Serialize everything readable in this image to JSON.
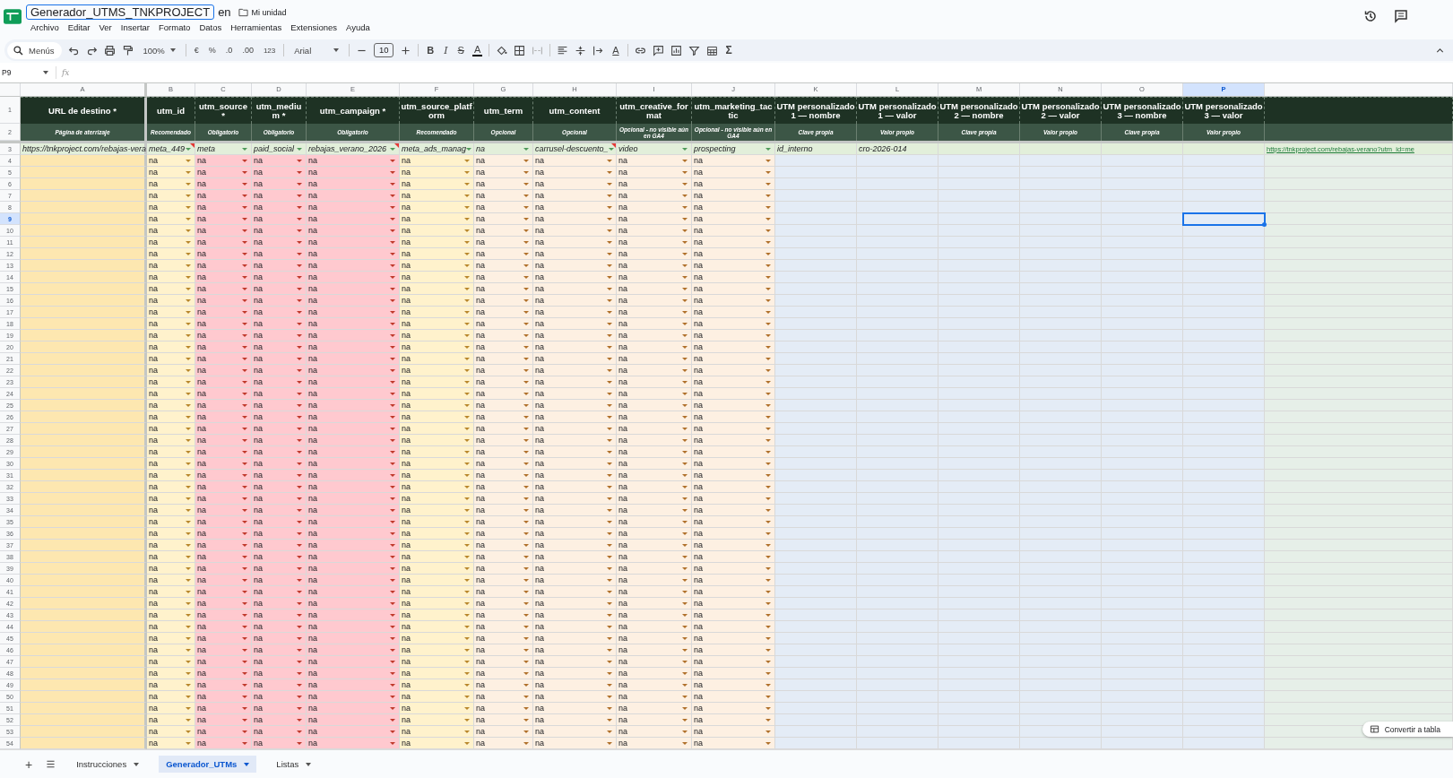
{
  "app": {
    "title": "Generador_UTMS_TNKPROJECT",
    "location_prefix": "en",
    "location": "Mi unidad",
    "menu": [
      "Archivo",
      "Editar",
      "Ver",
      "Insertar",
      "Formato",
      "Datos",
      "Herramientas",
      "Extensiones",
      "Ayuda"
    ]
  },
  "toolbar": {
    "search": "Menús",
    "zoom": "100%",
    "currency": "€",
    "percent": "%",
    "decrease_decimals": ".0",
    "increase_decimals": ".00",
    "more_formats": "123",
    "font": "Arial",
    "font_size": "10",
    "bold": "B",
    "italic": "I",
    "strikethrough": "S",
    "text_color": "A",
    "text_rotation": "A",
    "functions": "Σ"
  },
  "formula_bar": {
    "name_box": "P9",
    "fx": "fx"
  },
  "columns": [
    {
      "letter": "A",
      "title": "URL de destino *",
      "hint": "Página de aterrizaje",
      "kind": "url",
      "selected": false
    },
    {
      "letter": "B",
      "title": "utm_id",
      "hint": "Recomendado",
      "kind": "recommended",
      "selected": false
    },
    {
      "letter": "C",
      "title": "utm_source *",
      "hint": "Obligatorio",
      "kind": "required",
      "selected": false
    },
    {
      "letter": "D",
      "title": "utm_medium *",
      "hint": "Obligatorio",
      "kind": "required",
      "selected": false
    },
    {
      "letter": "E",
      "title": "utm_campaign *",
      "hint": "Obligatorio",
      "kind": "required",
      "selected": false
    },
    {
      "letter": "F",
      "title": "utm_source_platform",
      "hint": "Recomendado",
      "kind": "recommended",
      "selected": false
    },
    {
      "letter": "G",
      "title": "utm_term",
      "hint": "Opcional",
      "kind": "optional",
      "selected": false
    },
    {
      "letter": "H",
      "title": "utm_content",
      "hint": "Opcional",
      "kind": "optional",
      "selected": false
    },
    {
      "letter": "I",
      "title": "utm_creative_format",
      "hint": "Opcional - no visible aún en GA4",
      "kind": "optional",
      "selected": false
    },
    {
      "letter": "J",
      "title": "utm_marketing_tactic",
      "hint": "Opcional - no visible aún en GA4",
      "kind": "optional",
      "selected": false
    },
    {
      "letter": "K",
      "title": "UTM personalizado 1 — nombre",
      "hint": "Clave propia",
      "kind": "custom",
      "selected": false
    },
    {
      "letter": "L",
      "title": "UTM personalizado 1 — valor",
      "hint": "Valor propio",
      "kind": "custom",
      "selected": false
    },
    {
      "letter": "M",
      "title": "UTM personalizado 2 — nombre",
      "hint": "Clave propia",
      "kind": "custom",
      "selected": false
    },
    {
      "letter": "N",
      "title": "UTM personalizado 2 — valor",
      "hint": "Valor propio",
      "kind": "custom",
      "selected": false
    },
    {
      "letter": "O",
      "title": "UTM personalizado 3 — nombre",
      "hint": "Clave propia",
      "kind": "custom",
      "selected": false
    },
    {
      "letter": "P",
      "title": "UTM personalizado 3 — valor",
      "hint": "Valor propio",
      "kind": "custom",
      "selected": true
    }
  ],
  "header_rows": [
    "1",
    "2"
  ],
  "example_row": {
    "number": "3",
    "cells": [
      {
        "value": "https://tnkproject.com/rebajas-vera",
        "kind": "text",
        "note": false
      },
      {
        "value": "meta_449",
        "kind": "dropdown",
        "note": true
      },
      {
        "value": "meta",
        "kind": "dropdown",
        "note": false
      },
      {
        "value": "paid_social",
        "kind": "dropdown",
        "note": false
      },
      {
        "value": "rebajas_verano_2026",
        "kind": "dropdown",
        "note": true
      },
      {
        "value": "meta_ads_manag",
        "kind": "dropdown",
        "note": false
      },
      {
        "value": "na",
        "kind": "dropdown",
        "note": false
      },
      {
        "value": "carrusel-descuento_",
        "kind": "dropdown",
        "note": true
      },
      {
        "value": "video",
        "kind": "dropdown",
        "note": false
      },
      {
        "value": "prospecting",
        "kind": "dropdown",
        "note": false
      },
      {
        "value": "id_interno",
        "kind": "text",
        "note": false
      },
      {
        "value": "cro-2026-014",
        "kind": "text",
        "note": false
      }
    ],
    "generated_url": "https://tnkproject.com/rebajas-verano?utm_id=me"
  },
  "rows": [
    {
      "number": "4",
      "selected": false,
      "cells": [
        "na",
        "na",
        "na",
        "na",
        "na",
        "na",
        "na",
        "na",
        "na"
      ]
    },
    {
      "number": "5",
      "selected": false,
      "cells": [
        "na",
        "na",
        "na",
        "na",
        "na",
        "na",
        "na",
        "na",
        "na"
      ]
    },
    {
      "number": "6",
      "selected": false,
      "cells": [
        "na",
        "na",
        "na",
        "na",
        "na",
        "na",
        "na",
        "na",
        "na"
      ]
    },
    {
      "number": "7",
      "selected": false,
      "cells": [
        "na",
        "na",
        "na",
        "na",
        "na",
        "na",
        "na",
        "na",
        "na"
      ]
    },
    {
      "number": "8",
      "selected": false,
      "cells": [
        "na",
        "na",
        "na",
        "na",
        "na",
        "na",
        "na",
        "na",
        "na"
      ]
    },
    {
      "number": "9",
      "selected": true,
      "cells": [
        "na",
        "na",
        "na",
        "na",
        "na",
        "na",
        "na",
        "na",
        "na"
      ]
    },
    {
      "number": "10",
      "selected": false,
      "cells": [
        "na",
        "na",
        "na",
        "na",
        "na",
        "na",
        "na",
        "na",
        "na"
      ]
    },
    {
      "number": "11",
      "selected": false,
      "cells": [
        "na",
        "na",
        "na",
        "na",
        "na",
        "na",
        "na",
        "na",
        "na"
      ]
    },
    {
      "number": "12",
      "selected": false,
      "cells": [
        "na",
        "na",
        "na",
        "na",
        "na",
        "na",
        "na",
        "na",
        "na"
      ]
    },
    {
      "number": "13",
      "selected": false,
      "cells": [
        "na",
        "na",
        "na",
        "na",
        "na",
        "na",
        "na",
        "na",
        "na"
      ]
    },
    {
      "number": "14",
      "selected": false,
      "cells": [
        "na",
        "na",
        "na",
        "na",
        "na",
        "na",
        "na",
        "na",
        "na"
      ]
    },
    {
      "number": "15",
      "selected": false,
      "cells": [
        "na",
        "na",
        "na",
        "na",
        "na",
        "na",
        "na",
        "na",
        "na"
      ]
    },
    {
      "number": "16",
      "selected": false,
      "cells": [
        "na",
        "na",
        "na",
        "na",
        "na",
        "na",
        "na",
        "na",
        "na"
      ]
    },
    {
      "number": "17",
      "selected": false,
      "cells": [
        "na",
        "na",
        "na",
        "na",
        "na",
        "na",
        "na",
        "na",
        "na"
      ]
    },
    {
      "number": "18",
      "selected": false,
      "cells": [
        "na",
        "na",
        "na",
        "na",
        "na",
        "na",
        "na",
        "na",
        "na"
      ]
    },
    {
      "number": "19",
      "selected": false,
      "cells": [
        "na",
        "na",
        "na",
        "na",
        "na",
        "na",
        "na",
        "na",
        "na"
      ]
    },
    {
      "number": "20",
      "selected": false,
      "cells": [
        "na",
        "na",
        "na",
        "na",
        "na",
        "na",
        "na",
        "na",
        "na"
      ]
    },
    {
      "number": "21",
      "selected": false,
      "cells": [
        "na",
        "na",
        "na",
        "na",
        "na",
        "na",
        "na",
        "na",
        "na"
      ]
    },
    {
      "number": "22",
      "selected": false,
      "cells": [
        "na",
        "na",
        "na",
        "na",
        "na",
        "na",
        "na",
        "na",
        "na"
      ]
    },
    {
      "number": "23",
      "selected": false,
      "cells": [
        "na",
        "na",
        "na",
        "na",
        "na",
        "na",
        "na",
        "na",
        "na"
      ]
    },
    {
      "number": "24",
      "selected": false,
      "cells": [
        "na",
        "na",
        "na",
        "na",
        "na",
        "na",
        "na",
        "na",
        "na"
      ]
    },
    {
      "number": "25",
      "selected": false,
      "cells": [
        "na",
        "na",
        "na",
        "na",
        "na",
        "na",
        "na",
        "na",
        "na"
      ]
    },
    {
      "number": "26",
      "selected": false,
      "cells": [
        "na",
        "na",
        "na",
        "na",
        "na",
        "na",
        "na",
        "na",
        "na"
      ]
    },
    {
      "number": "27",
      "selected": false,
      "cells": [
        "na",
        "na",
        "na",
        "na",
        "na",
        "na",
        "na",
        "na",
        "na"
      ]
    },
    {
      "number": "28",
      "selected": false,
      "cells": [
        "na",
        "na",
        "na",
        "na",
        "na",
        "na",
        "na",
        "na",
        "na"
      ]
    },
    {
      "number": "29",
      "selected": false,
      "cells": [
        "na",
        "na",
        "na",
        "na",
        "na",
        "na",
        "na",
        "na",
        "na"
      ]
    },
    {
      "number": "30",
      "selected": false,
      "cells": [
        "na",
        "na",
        "na",
        "na",
        "na",
        "na",
        "na",
        "na",
        "na"
      ]
    },
    {
      "number": "31",
      "selected": false,
      "cells": [
        "na",
        "na",
        "na",
        "na",
        "na",
        "na",
        "na",
        "na",
        "na"
      ]
    },
    {
      "number": "32",
      "selected": false,
      "cells": [
        "na",
        "na",
        "na",
        "na",
        "na",
        "na",
        "na",
        "na",
        "na"
      ]
    },
    {
      "number": "33",
      "selected": false,
      "cells": [
        "na",
        "na",
        "na",
        "na",
        "na",
        "na",
        "na",
        "na",
        "na"
      ]
    },
    {
      "number": "34",
      "selected": false,
      "cells": [
        "na",
        "na",
        "na",
        "na",
        "na",
        "na",
        "na",
        "na",
        "na"
      ]
    },
    {
      "number": "35",
      "selected": false,
      "cells": [
        "na",
        "na",
        "na",
        "na",
        "na",
        "na",
        "na",
        "na",
        "na"
      ]
    },
    {
      "number": "36",
      "selected": false,
      "cells": [
        "na",
        "na",
        "na",
        "na",
        "na",
        "na",
        "na",
        "na",
        "na"
      ]
    },
    {
      "number": "37",
      "selected": false,
      "cells": [
        "na",
        "na",
        "na",
        "na",
        "na",
        "na",
        "na",
        "na",
        "na"
      ]
    },
    {
      "number": "38",
      "selected": false,
      "cells": [
        "na",
        "na",
        "na",
        "na",
        "na",
        "na",
        "na",
        "na",
        "na"
      ]
    },
    {
      "number": "39",
      "selected": false,
      "cells": [
        "na",
        "na",
        "na",
        "na",
        "na",
        "na",
        "na",
        "na",
        "na"
      ]
    },
    {
      "number": "40",
      "selected": false,
      "cells": [
        "na",
        "na",
        "na",
        "na",
        "na",
        "na",
        "na",
        "na",
        "na"
      ]
    },
    {
      "number": "41",
      "selected": false,
      "cells": [
        "na",
        "na",
        "na",
        "na",
        "na",
        "na",
        "na",
        "na",
        "na"
      ]
    },
    {
      "number": "42",
      "selected": false,
      "cells": [
        "na",
        "na",
        "na",
        "na",
        "na",
        "na",
        "na",
        "na",
        "na"
      ]
    },
    {
      "number": "43",
      "selected": false,
      "cells": [
        "na",
        "na",
        "na",
        "na",
        "na",
        "na",
        "na",
        "na",
        "na"
      ]
    },
    {
      "number": "44",
      "selected": false,
      "cells": [
        "na",
        "na",
        "na",
        "na",
        "na",
        "na",
        "na",
        "na",
        "na"
      ]
    },
    {
      "number": "45",
      "selected": false,
      "cells": [
        "na",
        "na",
        "na",
        "na",
        "na",
        "na",
        "na",
        "na",
        "na"
      ]
    },
    {
      "number": "46",
      "selected": false,
      "cells": [
        "na",
        "na",
        "na",
        "na",
        "na",
        "na",
        "na",
        "na",
        "na"
      ]
    },
    {
      "number": "47",
      "selected": false,
      "cells": [
        "na",
        "na",
        "na",
        "na",
        "na",
        "na",
        "na",
        "na",
        "na"
      ]
    },
    {
      "number": "48",
      "selected": false,
      "cells": [
        "na",
        "na",
        "na",
        "na",
        "na",
        "na",
        "na",
        "na",
        "na"
      ]
    },
    {
      "number": "49",
      "selected": false,
      "cells": [
        "na",
        "na",
        "na",
        "na",
        "na",
        "na",
        "na",
        "na",
        "na"
      ]
    },
    {
      "number": "50",
      "selected": false,
      "cells": [
        "na",
        "na",
        "na",
        "na",
        "na",
        "na",
        "na",
        "na",
        "na"
      ]
    },
    {
      "number": "51",
      "selected": false,
      "cells": [
        "na",
        "na",
        "na",
        "na",
        "na",
        "na",
        "na",
        "na",
        "na"
      ]
    },
    {
      "number": "52",
      "selected": false,
      "cells": [
        "na",
        "na",
        "na",
        "na",
        "na",
        "na",
        "na",
        "na",
        "na"
      ]
    },
    {
      "number": "53",
      "selected": false,
      "cells": [
        "na",
        "na",
        "na",
        "na",
        "na",
        "na",
        "na",
        "na",
        "na"
      ]
    },
    {
      "number": "54",
      "selected": false,
      "cells": [
        "na",
        "na",
        "na",
        "na",
        "na",
        "na",
        "na",
        "na",
        "na"
      ]
    }
  ],
  "convert_button": "Convertir a tabla",
  "sheet_tabs": [
    {
      "label": "Instrucciones",
      "selected": false
    },
    {
      "label": "Generador_UTMs",
      "selected": true
    },
    {
      "label": "Listas",
      "selected": false
    }
  ],
  "add_sheet": "+"
}
